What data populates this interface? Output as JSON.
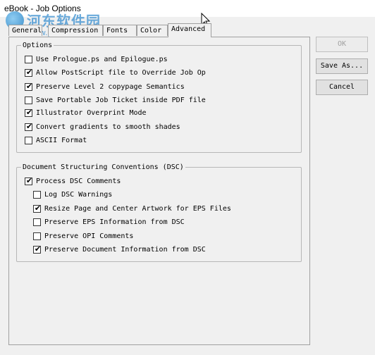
{
  "window": {
    "title": "eBook - Job Options"
  },
  "watermark": {
    "text": "河东软件园",
    "url": "www.pc0359.cn",
    "color": "#3a8fd0"
  },
  "tabs": [
    {
      "label": "General",
      "active": false
    },
    {
      "label": "Compression",
      "active": false
    },
    {
      "label": "Fonts",
      "active": false
    },
    {
      "label": "Color",
      "active": false
    },
    {
      "label": "Advanced",
      "active": true
    }
  ],
  "options_group": {
    "legend": "Options",
    "items": [
      {
        "label": "Use Prologue.ps and Epilogue.ps",
        "checked": false
      },
      {
        "label": "Allow PostScript file to Override Job Op",
        "checked": true
      },
      {
        "label": "Preserve Level 2 copypage Semantics",
        "checked": true
      },
      {
        "label": "Save Portable Job Ticket inside PDF file",
        "checked": false
      },
      {
        "label": "Illustrator Overprint Mode",
        "checked": true
      },
      {
        "label": "Convert gradients to smooth shades",
        "checked": true
      },
      {
        "label": "ASCII Format",
        "checked": false
      }
    ]
  },
  "dsc_group": {
    "legend": "Document Structuring Conventions (DSC)",
    "items": [
      {
        "label": "Process DSC Comments",
        "checked": true
      },
      {
        "label": "Log DSC Warnings",
        "checked": false
      },
      {
        "label": "Resize Page and Center Artwork for EPS Files",
        "checked": true
      },
      {
        "label": "Preserve EPS Information from DSC",
        "checked": false
      },
      {
        "label": "Preserve OPI Comments",
        "checked": false
      },
      {
        "label": "Preserve Document Information from DSC",
        "checked": true
      }
    ]
  },
  "buttons": {
    "ok": {
      "label": "OK",
      "enabled": false
    },
    "save_as": {
      "label": "Save As...",
      "enabled": true
    },
    "cancel": {
      "label": "Cancel",
      "enabled": true
    }
  },
  "check_glyph": "✔"
}
